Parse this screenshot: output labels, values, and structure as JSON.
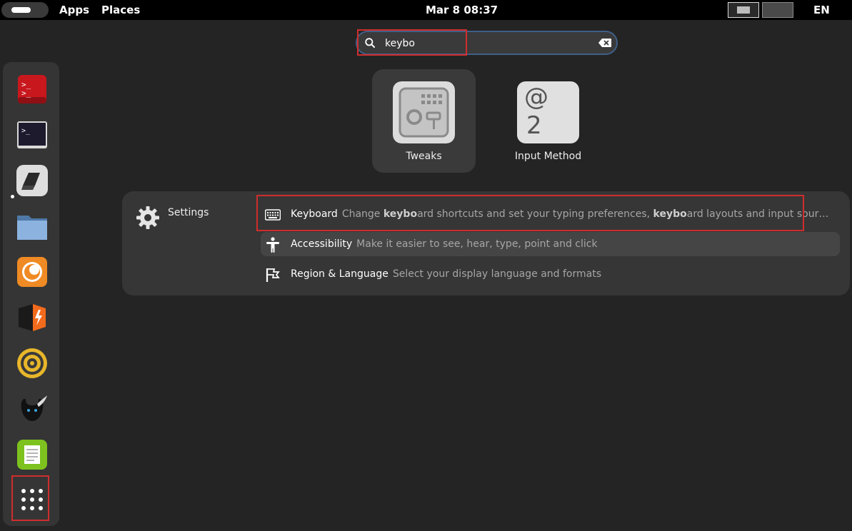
{
  "topbar": {
    "apps_label": "Apps",
    "places_label": "Places",
    "clock": "Mar 8  08:37",
    "input_source": "EN"
  },
  "search": {
    "value": "keybo",
    "icon": "search-icon",
    "clear_icon": "clear-icon"
  },
  "dock": {
    "items": [
      {
        "name": "terminal-red-icon"
      },
      {
        "name": "terminal-icon",
        "running": true
      },
      {
        "name": "app-icon"
      },
      {
        "name": "files-icon"
      },
      {
        "name": "firefox-icon"
      },
      {
        "name": "app-icon"
      },
      {
        "name": "app-icon"
      },
      {
        "name": "app-icon"
      },
      {
        "name": "text-editor-icon"
      },
      {
        "name": "show-apps-icon"
      }
    ]
  },
  "apps": [
    {
      "label": "Tweaks",
      "icon": "tweaks-icon",
      "selected": true
    },
    {
      "label": "Input Method",
      "icon": "input-method-icon",
      "glyph_top": "@",
      "glyph_bottom": "2"
    }
  ],
  "settings": {
    "provider": "Settings",
    "results": [
      {
        "title": "Keyboard",
        "icon": "keyboard-icon",
        "desc_parts": [
          "Change ",
          "keybo",
          "ard shortcuts and set your typing preferences, ",
          "keybo",
          "ard layouts and input sour…"
        ]
      },
      {
        "title": "Accessibility",
        "icon": "accessibility-icon",
        "desc": "Make it easier to see, hear, type, point and click"
      },
      {
        "title": "Region & Language",
        "icon": "flag-icon",
        "desc": "Select your display language and formats"
      }
    ]
  },
  "colors": {
    "background": "#242424",
    "topbar": "#000000",
    "highlight": "#d02d2d",
    "search_border": "#3f5f86"
  }
}
